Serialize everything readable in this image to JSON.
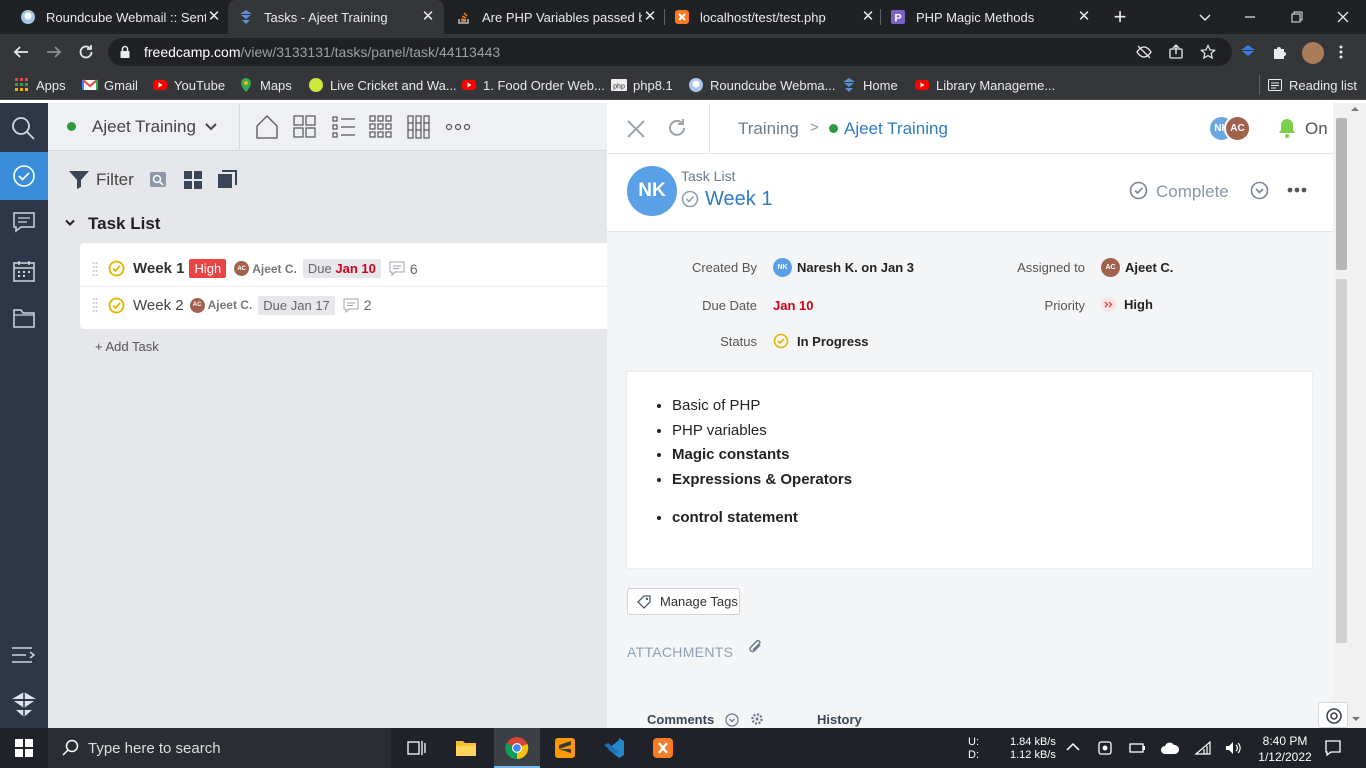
{
  "browser": {
    "tabs": [
      {
        "title": "Roundcube Webmail :: Sent",
        "icon": "roundcube-icon",
        "active": false
      },
      {
        "title": "Tasks - Ajeet Training",
        "icon": "freedcamp-icon",
        "active": true
      },
      {
        "title": "Are PHP Variables passed by",
        "icon": "stackoverflow-icon",
        "active": false
      },
      {
        "title": "localhost/test/test.php",
        "icon": "xampp-icon",
        "active": false
      },
      {
        "title": "PHP Magic Methods",
        "icon": "p-letter-icon",
        "active": false
      }
    ],
    "new_tab": "+",
    "url_host": "freedcamp.com",
    "url_path": "/view/3133131/tasks/panel/task/44113443",
    "bookmarks": [
      {
        "label": "Apps",
        "icon": "apps-grid-icon"
      },
      {
        "label": "Gmail",
        "icon": "gmail-icon"
      },
      {
        "label": "YouTube",
        "icon": "youtube-icon"
      },
      {
        "label": "Maps",
        "icon": "maps-pin-icon"
      },
      {
        "label": "Live Cricket and Wa...",
        "icon": "ball-icon"
      },
      {
        "label": "1. Food Order Web...",
        "icon": "youtube-icon"
      },
      {
        "label": "php8.1",
        "icon": "php-icon"
      },
      {
        "label": "Roundcube Webma...",
        "icon": "roundcube-icon"
      },
      {
        "label": "Home",
        "icon": "freedcamp-icon"
      },
      {
        "label": "Library Manageme...",
        "icon": "youtube-icon"
      }
    ],
    "reading_list": "Reading list"
  },
  "app": {
    "project_name": "Ajeet Training",
    "filter_label": "Filter",
    "task_list_title": "Task List",
    "tasks": [
      {
        "title": "Week 1",
        "priority": "High",
        "avatar": "AC",
        "assignee": "Ajeet C.",
        "due_prefix": "Due",
        "due_date": "Jan 10",
        "comments": "6"
      },
      {
        "title": "Week 2",
        "avatar": "AC",
        "assignee": "Ajeet C.",
        "due_label": "Due Jan 17",
        "comments": "2"
      }
    ],
    "add_task": "+ Add Task"
  },
  "panel": {
    "breadcrumb_parent": "Training",
    "breadcrumb_separator": ">",
    "breadcrumb_project": "Ajeet Training",
    "follower_avatars": [
      "NK",
      "AC"
    ],
    "notify_label": "On",
    "task_avatar": "NK",
    "task_list_label": "Task List",
    "task_title": "Week 1",
    "complete_label": "Complete",
    "fields": {
      "created_by_label": "Created By",
      "created_by_avatar": "NK",
      "created_by_value": "Naresh K. on Jan 3",
      "assigned_to_label": "Assigned to",
      "assigned_to_avatar": "AC",
      "assigned_to_value": "Ajeet C.",
      "due_date_label": "Due Date",
      "due_date_value": "Jan 10",
      "priority_label": "Priority",
      "priority_value": "High",
      "status_label": "Status",
      "status_value": "In Progress"
    },
    "description_items": [
      {
        "text": "Basic of PHP",
        "bold": false
      },
      {
        "text": "PHP variables",
        "bold": false
      },
      {
        "text": "Magic constants",
        "bold": true
      },
      {
        "text": "Expressions & Operators",
        "bold": true
      },
      {
        "text": "control statement",
        "bold": true
      }
    ],
    "manage_tags": "Manage Tags",
    "attachments_label": "ATTACHMENTS",
    "comments_tab": "Comments",
    "history_tab": "History"
  },
  "taskbar": {
    "search_placeholder": "Type here to search",
    "net_up_label": "U:",
    "net_down_label": "D:",
    "net_up": "1.84 kB/s",
    "net_down": "1.12 kB/s",
    "time": "8:40 PM",
    "date": "1/12/2022"
  },
  "colors": {
    "accent_blue": "#3a8dd8",
    "link_blue": "#2f7cc1",
    "priority_red": "#e94545",
    "due_red": "#d0021b",
    "status_yellow": "#e5b400",
    "sidebar_dark": "#2d3748"
  }
}
